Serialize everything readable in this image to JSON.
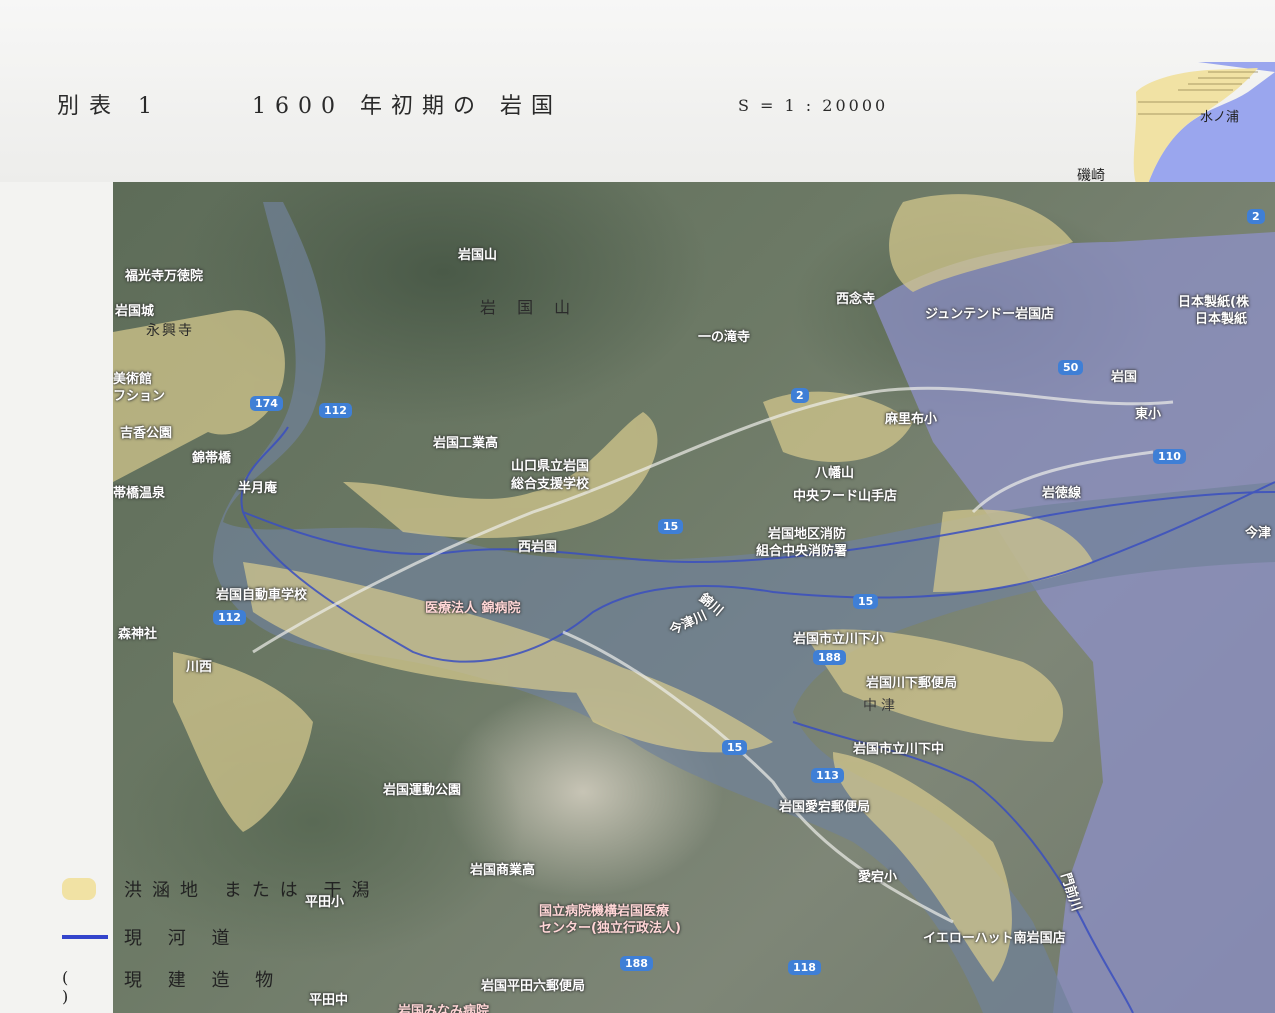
{
  "header": {
    "sheet_label": "別表 1",
    "title": "1600 年初期の 岩国",
    "scale": "S = 1 : 20000"
  },
  "corner_map": {
    "labels": [
      "水ノ浦",
      "磯崎"
    ],
    "water_color": "#9aa6ee",
    "land_color": "#f1e2a4"
  },
  "map": {
    "mountain_label": "岩 国 山",
    "place_labels": [
      "岩国山",
      "福光寺万徳院",
      "岩国城",
      "永興寺",
      "美術館",
      "フション",
      "吉香公園",
      "錦帯橋",
      "帯橋温泉",
      "半月庵",
      "岩国工業高",
      "山口県立岩国",
      "総合支援学校",
      "西岩国",
      "岩国自動車学校",
      "医療法人 錦病院",
      "森神社",
      "川西",
      "岩国運動公園",
      "岩国商業高",
      "平田小",
      "国立病院機構岩国医療",
      "センター(独立行政法人)",
      "岩国平田六郵便局",
      "平田中",
      "岩国みなみ病院",
      "西念寺",
      "一の滝寺",
      "ジュンテンドー岩国店",
      "日本製紙(株",
      "日本製紙",
      "岩国",
      "東小",
      "麻里布小",
      "八幡山",
      "中央フード山手店",
      "岩国地区消防",
      "組合中央消防署",
      "岩国市立川下小",
      "岩国川下郵便局",
      "中津",
      "岩国市立川下中",
      "岩国愛宕郵便局",
      "愛宕小",
      "イエローハット南岩国店",
      "門前川",
      "今津川",
      "今津",
      "錦川",
      "岩徳線"
    ],
    "highways": [
      "174",
      "112",
      "2",
      "50",
      "110",
      "15",
      "15",
      "188",
      "15",
      "113",
      "118",
      "188",
      "112",
      "2"
    ]
  },
  "legend": [
    {
      "label": "洪涵地 または 干潟",
      "swatch_color": "#f1e2a4"
    },
    {
      "label": "現 河 道",
      "swatch_color": "#3344cc"
    },
    {
      "label": "現 建 造 物",
      "swatch_color": "#222222"
    }
  ],
  "legend_marker": "( )"
}
